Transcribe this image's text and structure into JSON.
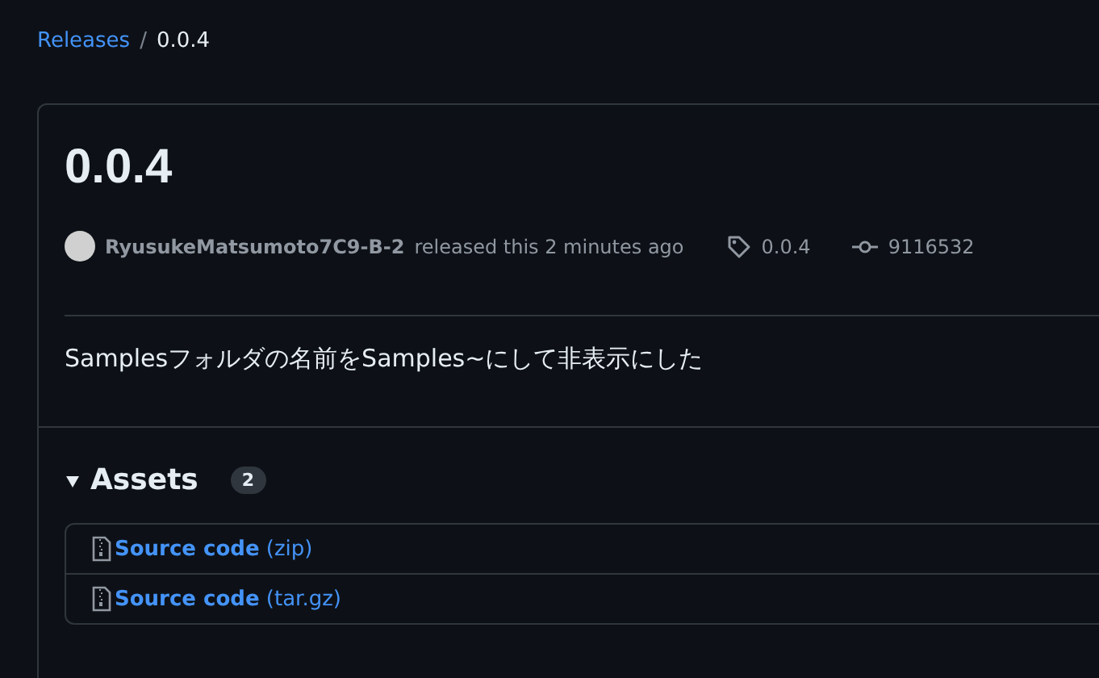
{
  "breadcrumb": {
    "parent": "Releases",
    "separator": "/",
    "current": "0.0.4"
  },
  "release": {
    "title": "0.0.4",
    "author": "RyusukeMatsumoto7C9-B-2",
    "action": "released this 2 minutes ago",
    "tag": "0.0.4",
    "commit": "9116532",
    "body": "Samplesフォルダの名前をSamples~にして非表示にした"
  },
  "assets": {
    "title": "Assets",
    "count": "2",
    "expanded": true,
    "items": [
      {
        "label": "**Source code** (zip)"
      },
      {
        "label": "**Source code** (tar.gz)"
      }
    ]
  }
}
